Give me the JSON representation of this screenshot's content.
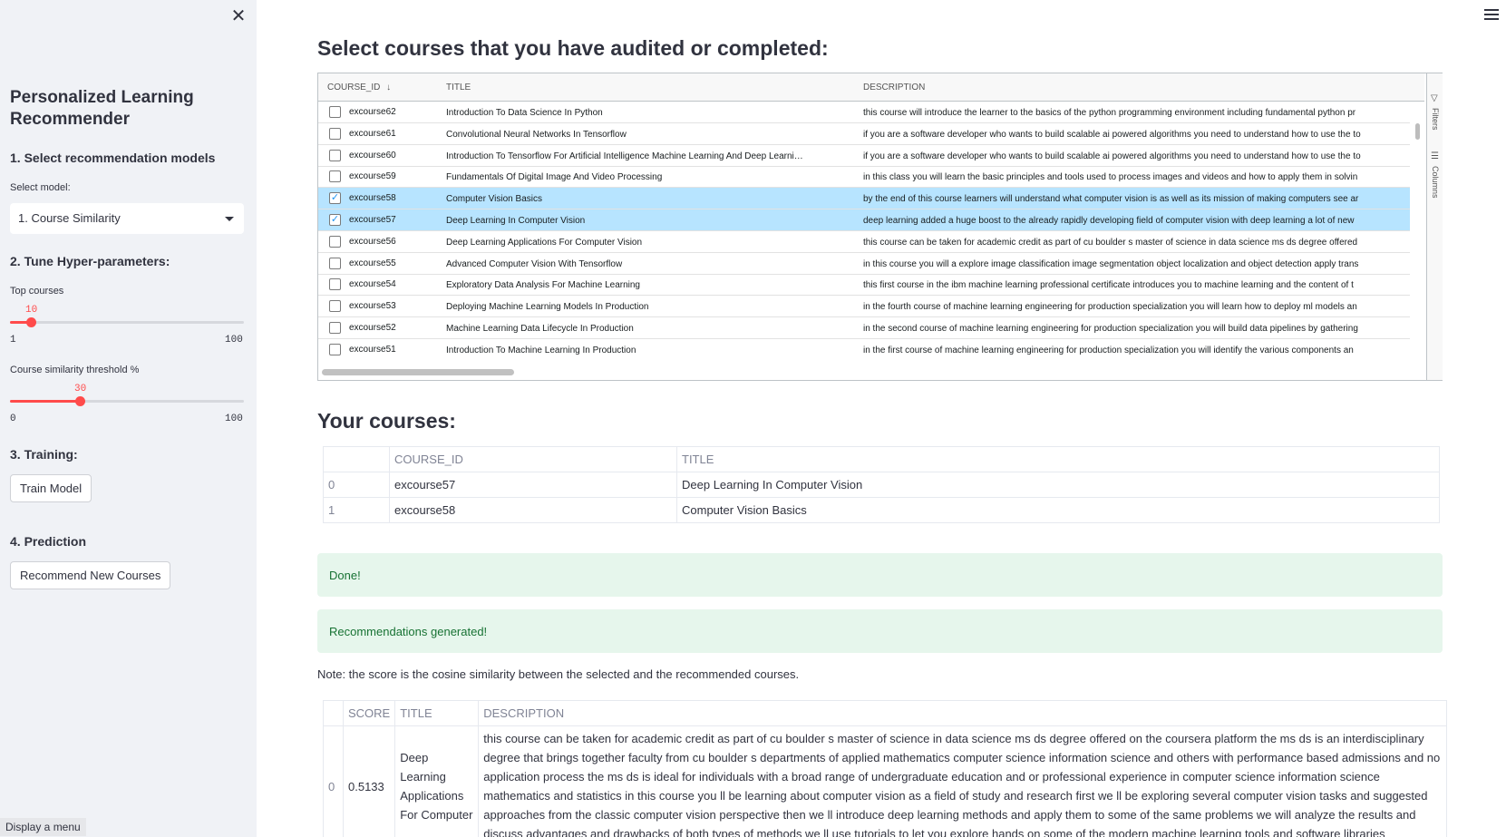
{
  "sidebar": {
    "app_title": "Personalized Learning Recommender",
    "section1": "1. Select recommendation models",
    "select_label": "Select model:",
    "select_value": "1. Course Similarity",
    "section2": "2. Tune Hyper-parameters:",
    "slider1": {
      "label": "Top courses",
      "value": "10",
      "min": "1",
      "max": "100",
      "fraction": 0.09
    },
    "slider2": {
      "label": "Course similarity threshold %",
      "value": "30",
      "min": "0",
      "max": "100",
      "fraction": 0.3
    },
    "section3": "3. Training:",
    "train_button": "Train Model",
    "section4": "4. Prediction",
    "recommend_button": "Recommend New Courses",
    "tooltip": "Display a menu"
  },
  "main": {
    "heading1": "Select courses that you have audited or completed:",
    "grid": {
      "headers": {
        "course_id": "COURSE_ID",
        "sort_icon": "↓",
        "title": "TITLE",
        "description": "DESCRIPTION"
      },
      "tools": {
        "filters": "Filters",
        "columns": "Columns"
      },
      "rows": [
        {
          "id": "excourse62",
          "title": "Introduction To Data Science In Python",
          "desc": "this course will introduce the learner to the basics of the python programming environment including fundamental python pr",
          "checked": false
        },
        {
          "id": "excourse61",
          "title": "Convolutional Neural Networks In Tensorflow",
          "desc": "if you are a software developer who wants to build scalable ai powered algorithms you need to understand how to use the to",
          "checked": false
        },
        {
          "id": "excourse60",
          "title": "Introduction To Tensorflow For Artificial Intelligence Machine Learning And Deep Learni…",
          "desc": "if you are a software developer who wants to build scalable ai powered algorithms you need to understand how to use the to",
          "checked": false
        },
        {
          "id": "excourse59",
          "title": "Fundamentals Of Digital Image And Video Processing",
          "desc": "in this class you will learn the basic principles and tools used to process images and videos and how to apply them in solvin",
          "checked": false
        },
        {
          "id": "excourse58",
          "title": "Computer Vision Basics",
          "desc": "by the end of this course learners will understand what computer vision is as well as its mission of making computers see ar",
          "checked": true
        },
        {
          "id": "excourse57",
          "title": "Deep Learning In Computer Vision",
          "desc": "deep learning added a huge boost to the already rapidly developing field of computer vision with deep learning a lot of new",
          "checked": true
        },
        {
          "id": "excourse56",
          "title": "Deep Learning Applications For Computer Vision",
          "desc": "this course can be taken for academic credit as part of cu boulder s master of science in data science ms ds degree offered",
          "checked": false
        },
        {
          "id": "excourse55",
          "title": "Advanced Computer Vision With Tensorflow",
          "desc": "in this course you will a explore image classification image segmentation object localization and object detection apply trans",
          "checked": false
        },
        {
          "id": "excourse54",
          "title": "Exploratory Data Analysis For Machine Learning",
          "desc": "this first course in the ibm machine learning professional certificate introduces you to machine learning and the content of t",
          "checked": false
        },
        {
          "id": "excourse53",
          "title": "Deploying Machine Learning Models In Production",
          "desc": "in the fourth course of machine learning engineering for production specialization you will learn how to deploy ml models an",
          "checked": false
        },
        {
          "id": "excourse52",
          "title": "Machine Learning Data Lifecycle In Production",
          "desc": "in the second course of machine learning engineering for production specialization you will build data pipelines by gathering",
          "checked": false
        },
        {
          "id": "excourse51",
          "title": "Introduction To Machine Learning In Production",
          "desc": "in the first course of machine learning engineering for production specialization you will identify the various components an",
          "checked": false
        }
      ]
    },
    "heading2": "Your courses:",
    "your_courses": {
      "headers": [
        "",
        "COURSE_ID",
        "TITLE"
      ],
      "rows": [
        [
          "0",
          "excourse57",
          "Deep Learning In Computer Vision"
        ],
        [
          "1",
          "excourse58",
          "Computer Vision Basics"
        ]
      ]
    },
    "alert_done": "Done!",
    "alert_generated": "Recommendations generated!",
    "note": "Note: the score is the cosine similarity between the selected and the recommended courses.",
    "recommendations": {
      "headers": [
        "",
        "SCORE",
        "TITLE",
        "DESCRIPTION"
      ],
      "rows": [
        [
          "0",
          "0.5133",
          "Deep Learning Applications For Computer",
          "this course can be taken for academic credit as part of cu boulder s master of science in data science ms ds degree offered on the coursera platform the ms ds is an interdisciplinary degree that brings together faculty from cu boulder s departments of applied mathematics computer science information science and others with performance based admissions and no application process the ms ds is ideal for individuals with a broad range of undergraduate education and or professional experience in computer science information science mathematics and statistics in this course you ll be learning about computer vision as a field of study and research first we ll be exploring several computer vision tasks and suggested approaches from the classic computer vision perspective then we ll introduce deep learning methods and apply them to some of the same problems we will analyze the results and discuss advantages and drawbacks of both types of methods we ll use tutorials to let you explore hands on some of the modern machine learning tools and software libraries"
        ]
      ]
    }
  }
}
